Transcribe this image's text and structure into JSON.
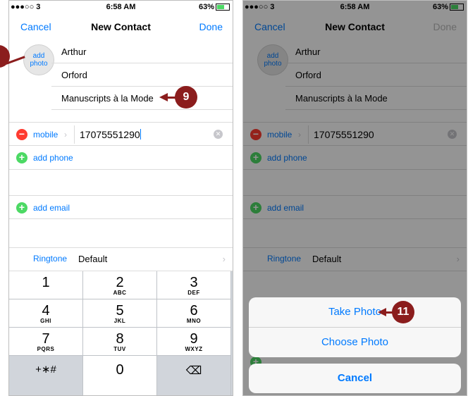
{
  "left": {
    "status": {
      "carrier": "●●●○○ 3",
      "time": "6:58 AM",
      "battery": "63%"
    },
    "nav": {
      "cancel": "Cancel",
      "title": "New Contact",
      "done": "Done"
    },
    "add_photo": {
      "line1": "add",
      "line2": "photo"
    },
    "fields": {
      "first": "Arthur",
      "last": "Orford",
      "company": "Manuscripts à la Mode"
    },
    "phone": {
      "label": "mobile",
      "value": "17075551290"
    },
    "add_phone": "add phone",
    "add_email": "add email",
    "ringtone": {
      "label": "Ringtone",
      "value": "Default"
    },
    "keypad": [
      {
        "d": "1",
        "s": ""
      },
      {
        "d": "2",
        "s": "ABC"
      },
      {
        "d": "3",
        "s": "DEF"
      },
      {
        "d": "4",
        "s": "GHI"
      },
      {
        "d": "5",
        "s": "JKL"
      },
      {
        "d": "6",
        "s": "MNO"
      },
      {
        "d": "7",
        "s": "PQRS"
      },
      {
        "d": "8",
        "s": "TUV"
      },
      {
        "d": "9",
        "s": "WXYZ"
      },
      {
        "d": "+∗#",
        "s": ""
      },
      {
        "d": "0",
        "s": ""
      },
      {
        "d": "⌫",
        "s": ""
      }
    ],
    "callout": "9"
  },
  "right": {
    "status": {
      "carrier": "●●●○○ 3",
      "time": "6:58 AM",
      "battery": "63%"
    },
    "nav": {
      "cancel": "Cancel",
      "title": "New Contact",
      "done": "Done"
    },
    "add_photo": {
      "line1": "add",
      "line2": "photo"
    },
    "fields": {
      "first": "Arthur",
      "last": "Orford",
      "company": "Manuscripts à la Mode"
    },
    "phone": {
      "label": "mobile",
      "value": "17075551290"
    },
    "add_phone": "add phone",
    "add_email": "add email",
    "ringtone": {
      "label": "Ringtone",
      "value": "Default"
    },
    "sheet": {
      "take_photo": "Take Photo",
      "choose_photo": "Choose Photo",
      "cancel": "Cancel"
    },
    "callout": "11"
  },
  "colors": {
    "accent": "#007aff",
    "callout": "#8b1d1d",
    "delete": "#ff3b30",
    "add": "#4cd964"
  }
}
